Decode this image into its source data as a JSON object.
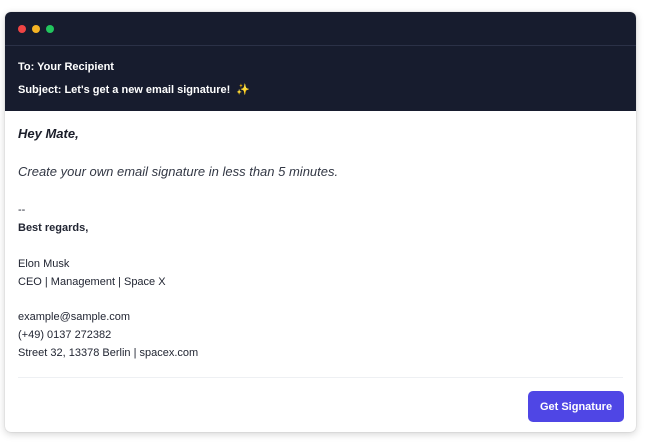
{
  "window": {
    "controls": [
      "close-dot",
      "minimize-dot",
      "maximize-dot"
    ]
  },
  "email": {
    "to_line": "To: Your Recipient",
    "subject_line": "Subject: Let's get a new email signature!",
    "subject_emoji": "✨"
  },
  "body": {
    "greeting": "Hey Mate,",
    "message": "Create your own email signature in less than 5 minutes."
  },
  "signature": {
    "separator": "--",
    "regards": "Best regards,",
    "name": "Elon Musk",
    "role": "CEO | Management | Space X",
    "email": "example@sample.com",
    "phone": "(+49) 0137 272382",
    "address": "Street 32, 13378 Berlin | spacex.com"
  },
  "actions": {
    "get_signature_label": "Get Signature"
  },
  "colors": {
    "header_bg": "#171c2e",
    "accent": "#4f46e5",
    "dot_red": "#ef4444",
    "dot_yellow": "#f5b324",
    "dot_green": "#22c55e"
  }
}
